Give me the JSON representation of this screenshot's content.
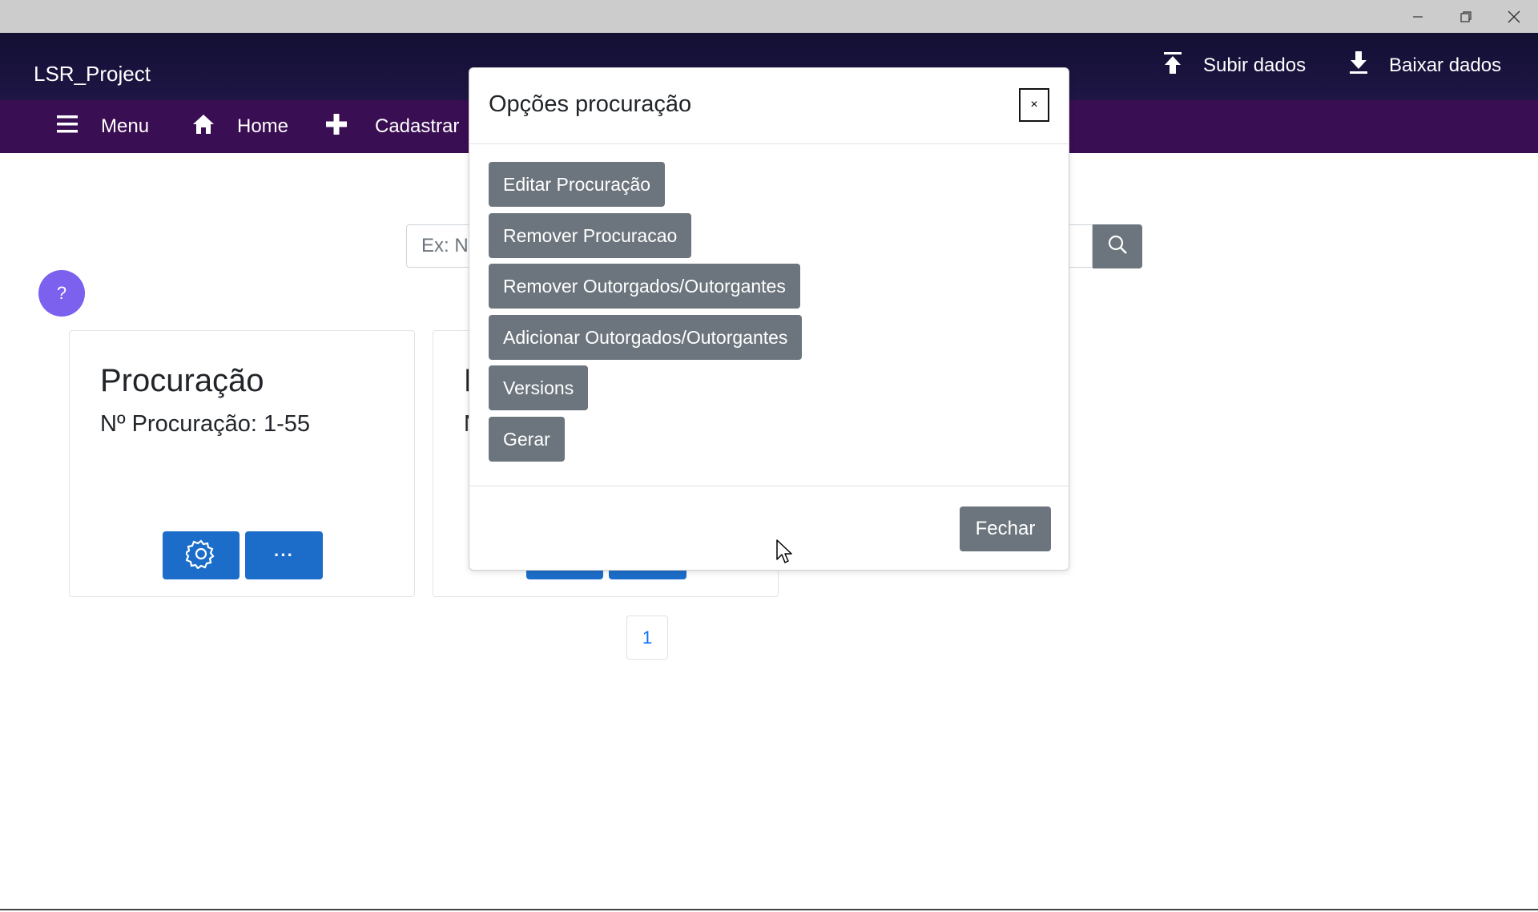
{
  "window": {
    "minimize_icon": "minimize-icon",
    "restore_icon": "restore-icon",
    "close_icon": "close-icon"
  },
  "header": {
    "brand": "LSR_Project",
    "upload_label": "Subir dados",
    "download_label": "Baixar dados",
    "upload_icon": "upload-icon",
    "download_icon": "download-icon"
  },
  "nav": {
    "items": [
      {
        "label": "Menu",
        "icon": "hamburger-icon"
      },
      {
        "label": "Home",
        "icon": "home-icon"
      },
      {
        "label": "Cadastrar",
        "icon": "plus-icon"
      }
    ]
  },
  "search": {
    "placeholder": "Ex: Nº"
  },
  "help": {
    "label": "?"
  },
  "cards": [
    {
      "title": "Procuração",
      "subtitle": "Nº Procuração: 1-55",
      "more_label": "···"
    },
    {
      "title": "P",
      "subtitle": "N"
    }
  ],
  "pagination": {
    "current": "1"
  },
  "modal": {
    "title": "Opções procuração",
    "close_label": "×",
    "options": [
      "Editar Procuração",
      "Remover Procuracao",
      "Remover Outorgados/Outorgantes",
      "Adicionar Outorgados/Outorgantes",
      "Versions",
      "Gerar"
    ],
    "footer_button": "Fechar"
  },
  "colors": {
    "header_bg": "#120f33",
    "nav_bg": "#3a0e52",
    "primary_blue": "#1c6dc9",
    "secondary_gray": "#6c757d",
    "help_purple": "#7b61ee"
  }
}
